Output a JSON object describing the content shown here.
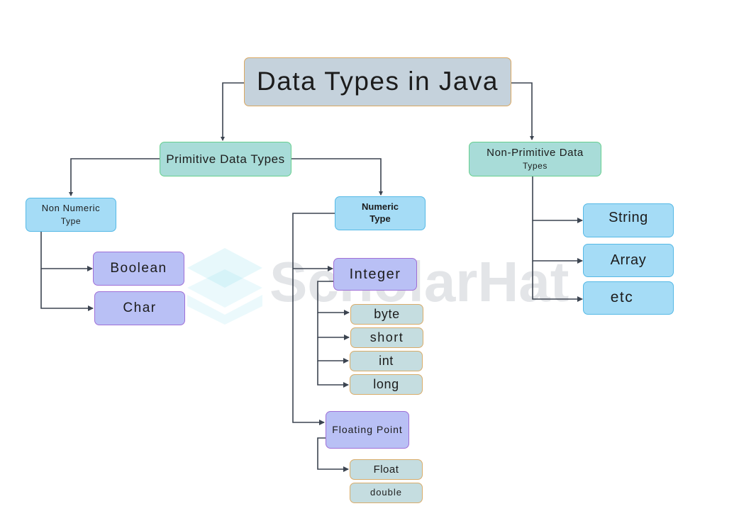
{
  "diagram": {
    "root": {
      "label": "Data Types in Java"
    },
    "primitive": {
      "label": "Primitive Data Types"
    },
    "non_primitive": {
      "line1": "Non-Primitive Data",
      "line2": "Types"
    },
    "non_numeric": {
      "line1": "Non Numeric",
      "line2": "Type",
      "children": [
        "Boolean",
        "Char"
      ]
    },
    "numeric": {
      "line1": "Numeric",
      "line2": "Type",
      "integer": {
        "label": "Integer",
        "children": [
          "byte",
          "short",
          "int",
          "long"
        ]
      },
      "floating": {
        "label": "Floating Point",
        "children": [
          "Float",
          "double"
        ]
      }
    },
    "non_primitive_children": [
      "String",
      "Array",
      "etc"
    ]
  },
  "watermark": {
    "text": "ScholarHat",
    "icon": "scholarhat-logo-icon"
  },
  "colors": {
    "connector": "#3c4450",
    "root_fill": "#c5d2dc",
    "teal_fill": "#a8dcd8",
    "sky_fill": "#a5dcf6",
    "lavender_fill": "#b9c0f5",
    "leaf_fill": "#c5dde0"
  }
}
